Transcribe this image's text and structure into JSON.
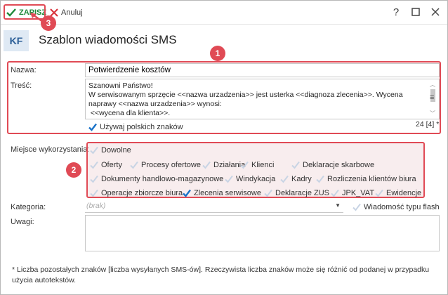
{
  "toolbar": {
    "save_label": "ZAPISZ",
    "cancel_label": "Anuluj",
    "help_label": "?",
    "accent_color": "#1e8a3a"
  },
  "header": {
    "logo": "KF",
    "title": "Szablon wiadomości SMS"
  },
  "form": {
    "name_label": "Nazwa:",
    "name_value": "Potwierdzenie kosztów",
    "content_label": "Treść:",
    "content_value": "Szanowni Państwo!\nW serwisowanym sprzęcie <<nazwa urzadzenia>> jest usterka <<diagnoza zlecenia>>. Wycena naprawy <<nazwa urzadzenia>> wynosi:\n <<wycena dla klienta>>.",
    "polish_chars_label": "Używaj polskich znaków",
    "polish_chars_checked": true,
    "counter": "24 [4] *",
    "usage_label": "Miejsce wykorzystania:",
    "usage_options": [
      {
        "label": "Dowolne",
        "checked": false
      },
      {
        "label": "Oferty",
        "checked": false
      },
      {
        "label": "Procesy ofertowe",
        "checked": false
      },
      {
        "label": "Działania",
        "checked": false
      },
      {
        "label": "Klienci",
        "checked": false
      },
      {
        "label": "Deklaracje skarbowe",
        "checked": false
      },
      {
        "label": "Dokumenty handlowo-magazynowe",
        "checked": false
      },
      {
        "label": "Windykacja",
        "checked": false
      },
      {
        "label": "Kadry",
        "checked": false
      },
      {
        "label": "Rozliczenia klientów biura",
        "checked": false
      },
      {
        "label": "Operacje zbiorcze biura",
        "checked": false
      },
      {
        "label": "Zlecenia serwisowe",
        "checked": true
      },
      {
        "label": "Deklaracje ZUS",
        "checked": false
      },
      {
        "label": "JPK_VAT",
        "checked": false
      },
      {
        "label": "Ewidencje",
        "checked": false
      }
    ],
    "category_label": "Kategoria:",
    "category_placeholder": "(brak)",
    "flash_label": "Wiadomość typu flash",
    "flash_checked": false,
    "notes_label": "Uwagi:",
    "notes_value": ""
  },
  "annotations": {
    "badge_1": "1",
    "badge_2": "2",
    "badge_3": "3",
    "highlight_color": "#e04a55"
  },
  "footnote": "* Liczba pozostałych znaków [liczba wysyłanych SMS-ów]. Rzeczywista liczba znaków może się różnić od podanej w przypadku użycia autotekstów."
}
